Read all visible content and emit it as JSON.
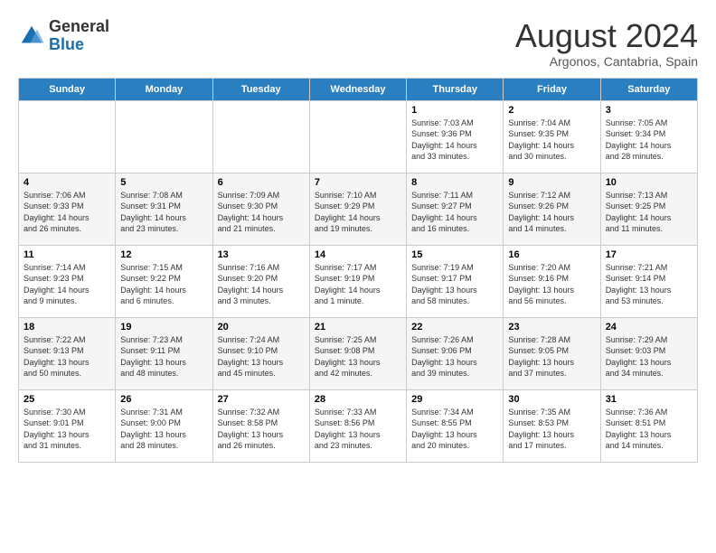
{
  "header": {
    "logo_general": "General",
    "logo_blue": "Blue",
    "month_year": "August 2024",
    "location": "Argonos, Cantabria, Spain"
  },
  "days": [
    "Sunday",
    "Monday",
    "Tuesday",
    "Wednesday",
    "Thursday",
    "Friday",
    "Saturday"
  ],
  "weeks": [
    [
      {
        "num": "",
        "info": ""
      },
      {
        "num": "",
        "info": ""
      },
      {
        "num": "",
        "info": ""
      },
      {
        "num": "",
        "info": ""
      },
      {
        "num": "1",
        "info": "Sunrise: 7:03 AM\nSunset: 9:36 PM\nDaylight: 14 hours\nand 33 minutes."
      },
      {
        "num": "2",
        "info": "Sunrise: 7:04 AM\nSunset: 9:35 PM\nDaylight: 14 hours\nand 30 minutes."
      },
      {
        "num": "3",
        "info": "Sunrise: 7:05 AM\nSunset: 9:34 PM\nDaylight: 14 hours\nand 28 minutes."
      }
    ],
    [
      {
        "num": "4",
        "info": "Sunrise: 7:06 AM\nSunset: 9:33 PM\nDaylight: 14 hours\nand 26 minutes."
      },
      {
        "num": "5",
        "info": "Sunrise: 7:08 AM\nSunset: 9:31 PM\nDaylight: 14 hours\nand 23 minutes."
      },
      {
        "num": "6",
        "info": "Sunrise: 7:09 AM\nSunset: 9:30 PM\nDaylight: 14 hours\nand 21 minutes."
      },
      {
        "num": "7",
        "info": "Sunrise: 7:10 AM\nSunset: 9:29 PM\nDaylight: 14 hours\nand 19 minutes."
      },
      {
        "num": "8",
        "info": "Sunrise: 7:11 AM\nSunset: 9:27 PM\nDaylight: 14 hours\nand 16 minutes."
      },
      {
        "num": "9",
        "info": "Sunrise: 7:12 AM\nSunset: 9:26 PM\nDaylight: 14 hours\nand 14 minutes."
      },
      {
        "num": "10",
        "info": "Sunrise: 7:13 AM\nSunset: 9:25 PM\nDaylight: 14 hours\nand 11 minutes."
      }
    ],
    [
      {
        "num": "11",
        "info": "Sunrise: 7:14 AM\nSunset: 9:23 PM\nDaylight: 14 hours\nand 9 minutes."
      },
      {
        "num": "12",
        "info": "Sunrise: 7:15 AM\nSunset: 9:22 PM\nDaylight: 14 hours\nand 6 minutes."
      },
      {
        "num": "13",
        "info": "Sunrise: 7:16 AM\nSunset: 9:20 PM\nDaylight: 14 hours\nand 3 minutes."
      },
      {
        "num": "14",
        "info": "Sunrise: 7:17 AM\nSunset: 9:19 PM\nDaylight: 14 hours\nand 1 minute."
      },
      {
        "num": "15",
        "info": "Sunrise: 7:19 AM\nSunset: 9:17 PM\nDaylight: 13 hours\nand 58 minutes."
      },
      {
        "num": "16",
        "info": "Sunrise: 7:20 AM\nSunset: 9:16 PM\nDaylight: 13 hours\nand 56 minutes."
      },
      {
        "num": "17",
        "info": "Sunrise: 7:21 AM\nSunset: 9:14 PM\nDaylight: 13 hours\nand 53 minutes."
      }
    ],
    [
      {
        "num": "18",
        "info": "Sunrise: 7:22 AM\nSunset: 9:13 PM\nDaylight: 13 hours\nand 50 minutes."
      },
      {
        "num": "19",
        "info": "Sunrise: 7:23 AM\nSunset: 9:11 PM\nDaylight: 13 hours\nand 48 minutes."
      },
      {
        "num": "20",
        "info": "Sunrise: 7:24 AM\nSunset: 9:10 PM\nDaylight: 13 hours\nand 45 minutes."
      },
      {
        "num": "21",
        "info": "Sunrise: 7:25 AM\nSunset: 9:08 PM\nDaylight: 13 hours\nand 42 minutes."
      },
      {
        "num": "22",
        "info": "Sunrise: 7:26 AM\nSunset: 9:06 PM\nDaylight: 13 hours\nand 39 minutes."
      },
      {
        "num": "23",
        "info": "Sunrise: 7:28 AM\nSunset: 9:05 PM\nDaylight: 13 hours\nand 37 minutes."
      },
      {
        "num": "24",
        "info": "Sunrise: 7:29 AM\nSunset: 9:03 PM\nDaylight: 13 hours\nand 34 minutes."
      }
    ],
    [
      {
        "num": "25",
        "info": "Sunrise: 7:30 AM\nSunset: 9:01 PM\nDaylight: 13 hours\nand 31 minutes."
      },
      {
        "num": "26",
        "info": "Sunrise: 7:31 AM\nSunset: 9:00 PM\nDaylight: 13 hours\nand 28 minutes."
      },
      {
        "num": "27",
        "info": "Sunrise: 7:32 AM\nSunset: 8:58 PM\nDaylight: 13 hours\nand 26 minutes."
      },
      {
        "num": "28",
        "info": "Sunrise: 7:33 AM\nSunset: 8:56 PM\nDaylight: 13 hours\nand 23 minutes."
      },
      {
        "num": "29",
        "info": "Sunrise: 7:34 AM\nSunset: 8:55 PM\nDaylight: 13 hours\nand 20 minutes."
      },
      {
        "num": "30",
        "info": "Sunrise: 7:35 AM\nSunset: 8:53 PM\nDaylight: 13 hours\nand 17 minutes."
      },
      {
        "num": "31",
        "info": "Sunrise: 7:36 AM\nSunset: 8:51 PM\nDaylight: 13 hours\nand 14 minutes."
      }
    ]
  ]
}
